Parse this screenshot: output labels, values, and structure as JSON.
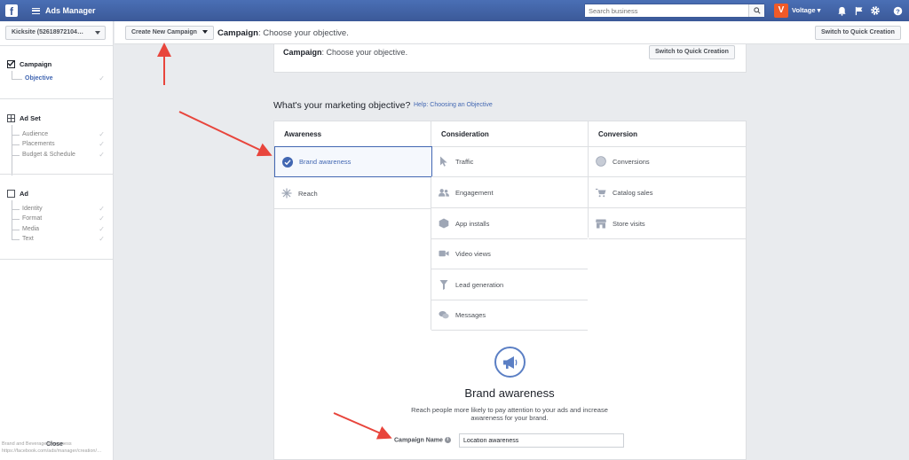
{
  "topbar": {
    "logo": "f",
    "title": "Ads Manager",
    "search_placeholder": "Search business",
    "avatar_letter": "V",
    "account_name": "Voltage"
  },
  "sidebar": {
    "account_select": "Kicksite (526189721​04…",
    "sections": [
      {
        "title": "Campaign",
        "items": [
          {
            "label": "Objective"
          }
        ]
      },
      {
        "title": "Ad Set",
        "items": [
          {
            "label": "Audience"
          },
          {
            "label": "Placements"
          },
          {
            "label": "Budget & Schedule"
          }
        ]
      },
      {
        "title": "Ad",
        "items": [
          {
            "label": "Identity"
          },
          {
            "label": "Format"
          },
          {
            "label": "Media"
          },
          {
            "label": "Text"
          }
        ]
      }
    ],
    "close_label": "Close"
  },
  "subbar": {
    "create_button": "Create New Campaign",
    "heading_bold": "Campaign",
    "heading_rest": ": Choose your objective.",
    "quick_button": "Switch to Quick Creation"
  },
  "card": {
    "heading_bold": "Campaign",
    "heading_rest": ": Choose your objective.",
    "quick_button": "Switch to Quick Creation"
  },
  "objective": {
    "question": "What's your marketing objective?",
    "help_link": "Help: Choosing an Objective",
    "columns": [
      {
        "header": "Awareness",
        "items": [
          "Brand awareness",
          "Reach"
        ]
      },
      {
        "header": "Consideration",
        "items": [
          "Traffic",
          "Engagement",
          "App installs",
          "Video views",
          "Lead generation",
          "Messages"
        ]
      },
      {
        "header": "Conversion",
        "items": [
          "Conversions",
          "Catalog sales",
          "Store visits"
        ]
      }
    ],
    "selected": "Brand awareness"
  },
  "detail": {
    "title": "Brand awareness",
    "description": "Reach people more likely to pay attention to your ads and increase awareness for your brand.",
    "campaign_name_label": "Campaign Name",
    "campaign_name_value": "Location awareness"
  },
  "status_bar": {
    "line1": "Brand and Beverage awareness",
    "line2": "https://facebook.com/ads/manager/creation/…"
  },
  "colors": {
    "brand": "#4267b2",
    "annotation_arrow": "#e8453c",
    "avatar": "#f05a28"
  }
}
